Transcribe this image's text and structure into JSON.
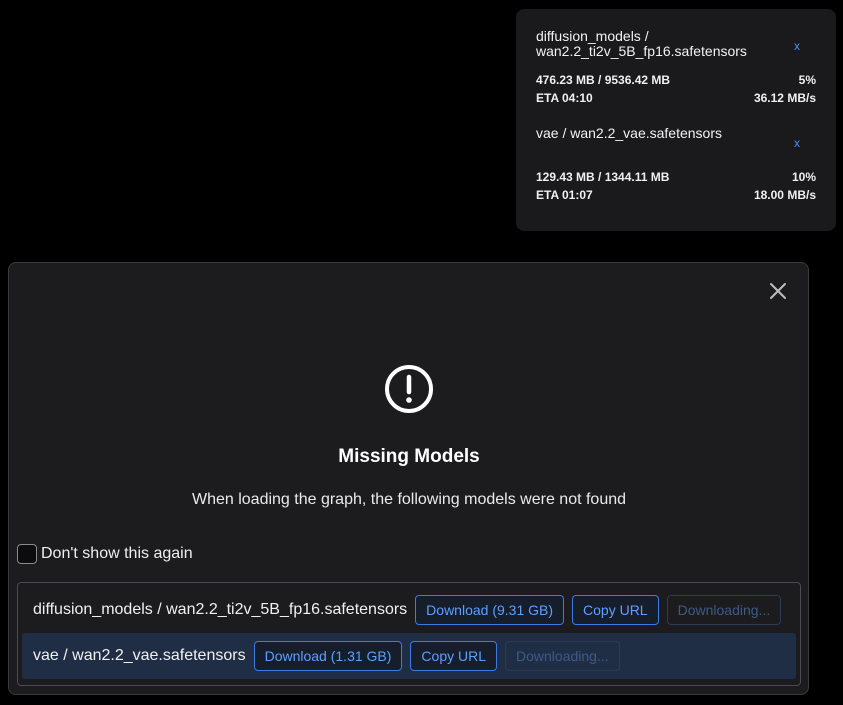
{
  "downloads": [
    {
      "name": "diffusion_models / wan2.2_ti2v_5B_fp16.safetensors",
      "progress_bytes": "476.23 MB / 9536.42 MB",
      "percent": "5%",
      "eta": "ETA 04:10",
      "speed": "36.12 MB/s",
      "cancel_label": "x"
    },
    {
      "name": "vae / wan2.2_vae.safetensors",
      "progress_bytes": "129.43 MB / 1344.11 MB",
      "percent": "10%",
      "eta": "ETA 01:07",
      "speed": "18.00 MB/s",
      "cancel_label": "x"
    }
  ],
  "dialog": {
    "title": "Missing Models",
    "description": "When loading the graph, the following models were not found",
    "dont_show_label": "Don't show this again",
    "dont_show_checked": false,
    "models": [
      {
        "name": "diffusion_models / wan2.2_ti2v_5B_fp16.safetensors",
        "download_label": "Download (9.31 GB)",
        "copy_label": "Copy URL",
        "status_label": "Downloading..."
      },
      {
        "name": "vae / wan2.2_vae.safetensors",
        "download_label": "Download (1.31 GB)",
        "copy_label": "Copy URL",
        "status_label": "Downloading..."
      }
    ]
  },
  "colors": {
    "accent": "#4c8dff",
    "dialog_bg": "#1c1c1e",
    "selected_row": "#1f2e45"
  },
  "icons": {
    "close": "close-icon",
    "warning": "exclamation-circle-icon"
  }
}
